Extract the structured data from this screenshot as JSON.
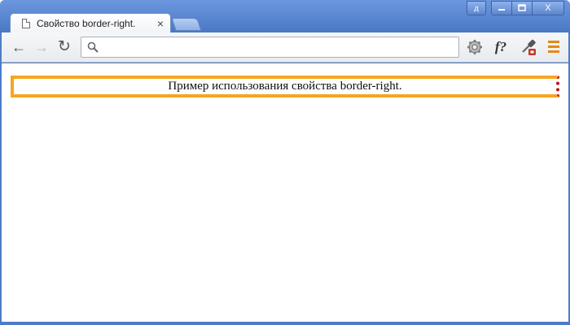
{
  "window": {
    "profile_badge": "д",
    "min_label": "—",
    "max_label": "□",
    "close_label": "X"
  },
  "tab": {
    "title": "Свойство border-right.",
    "close_glyph": "×"
  },
  "toolbar": {
    "back_glyph": "←",
    "forward_glyph": "→",
    "reload_glyph": "↻",
    "omnibox_value": "",
    "font_ext_label": "f?"
  },
  "page": {
    "demo_text": "Пример использования свойства border-right."
  },
  "colors": {
    "chrome_frame": "#4e7cc6",
    "border_main": "#f5a623",
    "border_right": "#c0101a",
    "menu_icon": "#e38a13"
  },
  "icons": {
    "tab": "page-icon",
    "omnibox": "search-icon",
    "ext1": "gear-icon",
    "ext2": "eyedropper-icon",
    "menu": "hamburger-menu-icon"
  }
}
